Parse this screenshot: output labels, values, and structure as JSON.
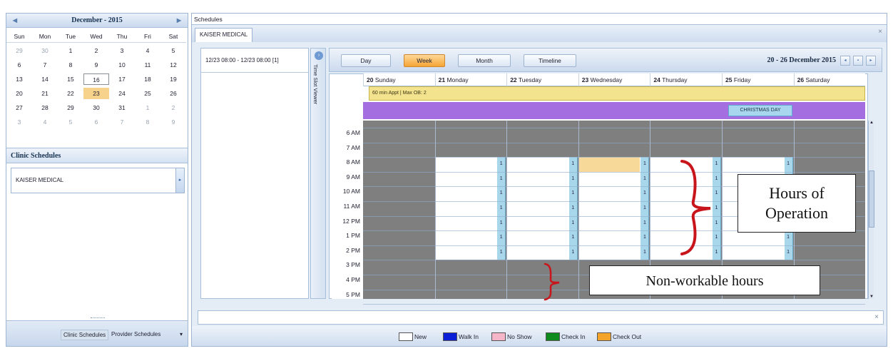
{
  "calendar": {
    "month_label": "December - 2015",
    "prev_arrow": "◀",
    "next_arrow": "▶",
    "weekdays": [
      "Sun",
      "Mon",
      "Tue",
      "Wed",
      "Thu",
      "Fri",
      "Sat"
    ],
    "weeks": [
      [
        "29",
        "30",
        "1",
        "2",
        "3",
        "4",
        "5"
      ],
      [
        "6",
        "7",
        "8",
        "9",
        "10",
        "11",
        "12"
      ],
      [
        "13",
        "14",
        "15",
        "16",
        "17",
        "18",
        "19"
      ],
      [
        "20",
        "21",
        "22",
        "23",
        "24",
        "25",
        "26"
      ],
      [
        "27",
        "28",
        "29",
        "30",
        "31",
        "1",
        "2"
      ],
      [
        "3",
        "4",
        "5",
        "6",
        "7",
        "8",
        "9"
      ]
    ],
    "today": "16",
    "selected": "23"
  },
  "clinic": {
    "title": "Clinic Schedules",
    "selected_value": "KAISER MEDICAL"
  },
  "left_footer": {
    "clinic_tab": "Clinic Schedules",
    "provider_tab": "Provider Schedules",
    "dropdown": "▾"
  },
  "schedules": {
    "title": "Schedules",
    "tab_label": "KAISER MEDICAL",
    "close": "×"
  },
  "slot_list": {
    "item": "12/23 08:00 - 12/23 08:00  [1]",
    "viewer_label": "Time Slot Viewer"
  },
  "toolbar": {
    "views": [
      "Day",
      "Week",
      "Month",
      "Timeline"
    ],
    "active_view": "Week",
    "range_label": "20 - 26 December 2015"
  },
  "days": [
    {
      "num": "20",
      "name": "Sunday"
    },
    {
      "num": "21",
      "name": "Monday"
    },
    {
      "num": "22",
      "name": "Tuesday"
    },
    {
      "num": "23",
      "name": "Wednesday"
    },
    {
      "num": "24",
      "name": "Thursday"
    },
    {
      "num": "25",
      "name": "Friday"
    },
    {
      "num": "26",
      "name": "Saturday"
    }
  ],
  "allday_appt": "60 min Appt | Max OB: 2",
  "holiday": "CHRISTMAS DAY",
  "time_labels": [
    "6 AM",
    "7 AM",
    "8 AM",
    "9 AM",
    "10 AM",
    "11 AM",
    "12 PM",
    "1 PM",
    "2 PM",
    "3 PM",
    "4 PM",
    "5 PM"
  ],
  "slot_count_label": "1",
  "legend": [
    {
      "label": "New",
      "color": "#ffffff"
    },
    {
      "label": "Walk In",
      "color": "#0a1fd6"
    },
    {
      "label": "No Show",
      "color": "#f4b6c8"
    },
    {
      "label": "Check In",
      "color": "#0f8a1e"
    },
    {
      "label": "Check Out",
      "color": "#f5a42a"
    }
  ],
  "annotations": {
    "hours_line1": "Hours of",
    "hours_line2": "Operation",
    "non_workable": "Non-workable hours"
  },
  "colors": {
    "accent_orange": "#f5a534",
    "purple_band": "#a56ee0",
    "allday_yellow": "#f3e38e",
    "nonwork_gray": "#7f7f7f",
    "slot_blue": "#a8d6ea",
    "brace_red": "#c8151b"
  }
}
